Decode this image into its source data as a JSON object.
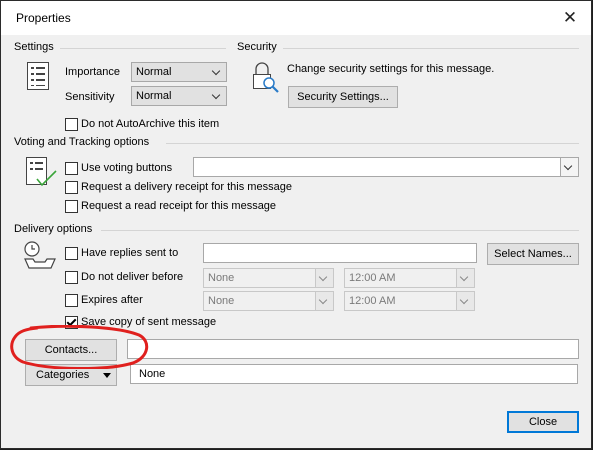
{
  "window": {
    "title": "Properties",
    "close_glyph": "✕"
  },
  "settings": {
    "heading": "Settings",
    "importance_label": "Importance",
    "importance_value": "Normal",
    "sensitivity_label": "Sensitivity",
    "sensitivity_value": "Normal",
    "autoarchive_label": "Do not AutoArchive this item",
    "autoarchive_checked": false
  },
  "security": {
    "heading": "Security",
    "description": "Change security settings for this message.",
    "button_label": "Security Settings..."
  },
  "voting": {
    "heading": "Voting and Tracking options",
    "use_voting_label": "Use voting buttons",
    "use_voting_value": "",
    "delivery_receipt_label": "Request a delivery receipt for this message",
    "read_receipt_label": "Request a read receipt for this message"
  },
  "delivery": {
    "heading": "Delivery options",
    "replies_label": "Have replies sent to",
    "replies_value": "",
    "select_names_label": "Select Names...",
    "do_not_deliver_label": "Do not deliver before",
    "do_not_deliver_date": "None",
    "do_not_deliver_time": "12:00 AM",
    "expires_label": "Expires after",
    "expires_date": "None",
    "expires_time": "12:00 AM",
    "save_copy_label": "Save copy of sent message",
    "save_copy_checked": true
  },
  "contacts": {
    "button_label": "Contacts...",
    "value": ""
  },
  "categories": {
    "button_label": "Categories",
    "value": "None"
  },
  "footer": {
    "close_label": "Close"
  },
  "annotation": {
    "highlight_color": "#e0201e"
  },
  "colors": {
    "accent": "#0078d7",
    "checkmark_green": "#3aa53a"
  }
}
